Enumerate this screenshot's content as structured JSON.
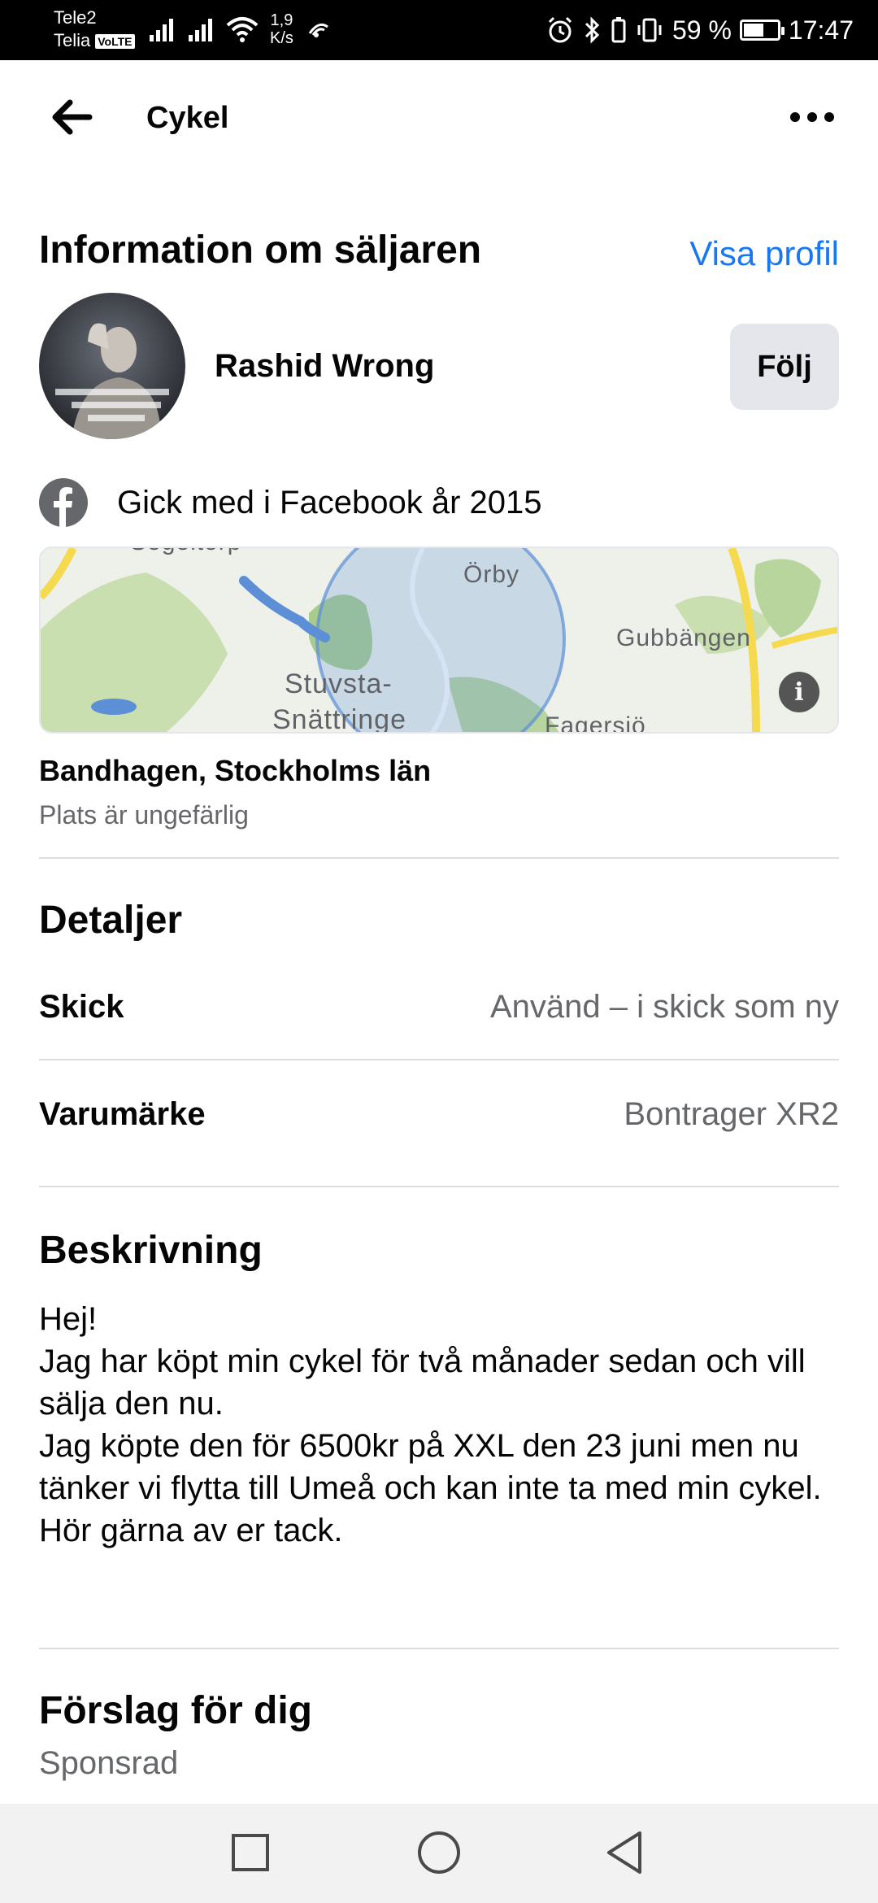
{
  "status_bar": {
    "carrier_1": "Tele2",
    "carrier_2": "Telia",
    "volte": "VoLTE",
    "net_speed_value": "1,9",
    "net_speed_unit": "K/s",
    "battery_percent": "59 %",
    "battery_level": 0.59,
    "time": "17:47"
  },
  "header": {
    "title": "Cykel"
  },
  "seller": {
    "section_title": "Information om säljaren",
    "view_profile": "Visa profil",
    "name": "Rashid Wrong",
    "follow": "Följ",
    "joined": "Gick med i Facebook år 2015"
  },
  "map": {
    "labels": [
      "Segeltorp",
      "Örby",
      "Gubbängen",
      "Stuvsta-",
      "Snättringe",
      "Fagersjö"
    ],
    "info": "i"
  },
  "location": {
    "name": "Bandhagen, Stockholms län",
    "note": "Plats är ungefärlig"
  },
  "details": {
    "title": "Detaljer",
    "rows": [
      {
        "label": "Skick",
        "value": "Använd – i skick som ny"
      },
      {
        "label": "Varumärke",
        "value": "Bontrager XR2"
      }
    ]
  },
  "description": {
    "title": "Beskrivning",
    "lines": [
      "Hej!",
      "Jag har köpt min cykel för två månader sedan och vill sälja den nu.",
      "Jag köpte den för 6500kr på XXL den 23 juni men nu tänker vi flytta till Umeå och kan inte ta med min cykel.",
      "Hör gärna av er tack."
    ]
  },
  "suggestions": {
    "title": "Förslag för dig",
    "sponsored": "Sponsrad"
  },
  "colors": {
    "accent": "#1877f2",
    "secondary_text": "#65676b",
    "button_bg": "#e4e6eb"
  }
}
